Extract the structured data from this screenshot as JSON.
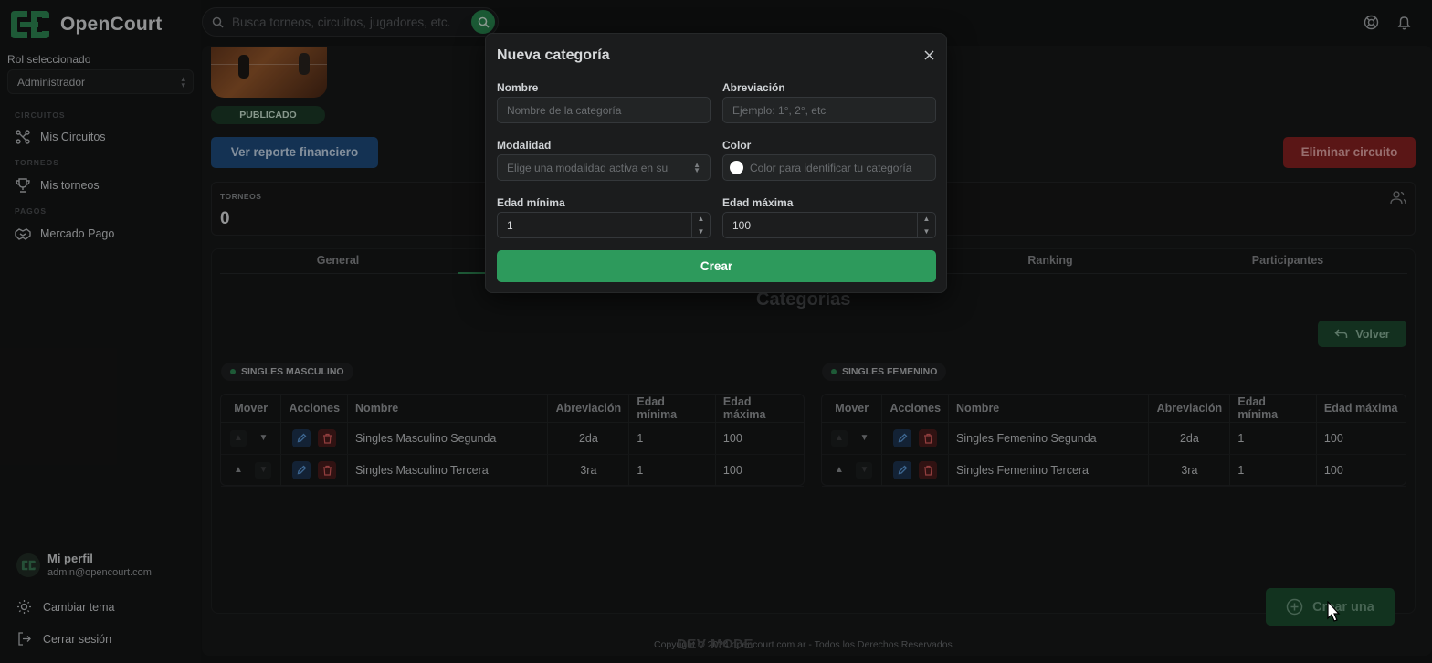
{
  "app": {
    "name": "OpenCourt"
  },
  "header": {
    "search_placeholder": "Busca torneos, circuitos, jugadores, etc."
  },
  "sidebar": {
    "role_label": "Rol seleccionado",
    "role_value": "Administrador",
    "sections": {
      "circuitos": "CIRCUITOS",
      "torneos": "TORNEOS",
      "pagos": "PAGOS"
    },
    "items": {
      "mis_circuitos": "Mis Circuitos",
      "mis_torneos": "Mis torneos",
      "mercado_pago": "Mercado Pago"
    },
    "profile": {
      "name": "Mi perfil",
      "email": "admin@opencourt.com"
    },
    "cambiar_tema": "Cambiar tema",
    "cerrar_sesion": "Cerrar sesión"
  },
  "circuit": {
    "status_badge": "PUBLICADO",
    "report_button": "Ver reporte financiero",
    "delete_button": "Eliminar circuito",
    "stats": {
      "label": "TORNEOS",
      "value": "0"
    }
  },
  "tabs": [
    "General",
    "Ranking",
    "Participantes"
  ],
  "categories": {
    "title": "Categorías",
    "back_button": "Volver",
    "columns": [
      "Mover",
      "Acciones",
      "Nombre",
      "Abreviación",
      "Edad mínima",
      "Edad máxima"
    ],
    "groups": [
      {
        "name": "SINGLES MASCULINO",
        "rows": [
          {
            "nombre": "Singles Masculino Segunda",
            "abreviacion": "2da",
            "edad_min": "1",
            "edad_max": "100"
          },
          {
            "nombre": "Singles Masculino Tercera",
            "abreviacion": "3ra",
            "edad_min": "1",
            "edad_max": "100"
          }
        ]
      },
      {
        "name": "SINGLES FEMENINO",
        "rows": [
          {
            "nombre": "Singles Femenino Segunda",
            "abreviacion": "2da",
            "edad_min": "1",
            "edad_max": "100"
          },
          {
            "nombre": "Singles Femenino Tercera",
            "abreviacion": "3ra",
            "edad_min": "1",
            "edad_max": "100"
          }
        ]
      }
    ],
    "create_button": "Crear una"
  },
  "footer": {
    "copyright": "Copyright © 2024 opencourt.com.ar - Todos los Derechos Reservados",
    "dev_mode": "DEV MODE"
  },
  "modal": {
    "title": "Nueva categoría",
    "fields": {
      "nombre": {
        "label": "Nombre",
        "placeholder": "Nombre de la categoría"
      },
      "abreviacion": {
        "label": "Abreviación",
        "placeholder": "Ejemplo: 1°, 2°, etc"
      },
      "modalidad": {
        "label": "Modalidad",
        "placeholder": "Elige una modalidad activa en su"
      },
      "color": {
        "label": "Color",
        "placeholder": "Color para identificar tu categoría"
      },
      "edad_minima": {
        "label": "Edad mínima",
        "value": "1"
      },
      "edad_maxima": {
        "label": "Edad máxima",
        "value": "100"
      }
    },
    "submit": "Crear"
  },
  "colors": {
    "accent": "#2d9a5c",
    "danger": "#8a2222",
    "info": "#1f4e80"
  }
}
